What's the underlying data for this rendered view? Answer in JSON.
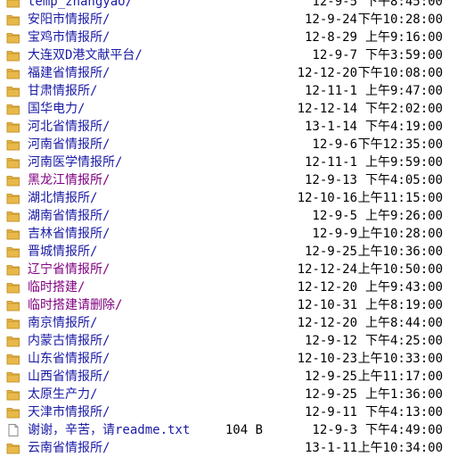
{
  "colors": {
    "link": "#1a1aa6",
    "visited": "#800080",
    "folder": "#e8b84a",
    "folder_dark": "#c9962c"
  },
  "entries": [
    {
      "name": "temp_zhangyao/",
      "type": "folder",
      "visited": false,
      "size": "",
      "date": "12-9-5",
      "time": "下午8:45:00"
    },
    {
      "name": "安阳市情报所/",
      "type": "folder",
      "visited": false,
      "size": "",
      "date": "12-9-24",
      "time": "下午10:28:00"
    },
    {
      "name": "宝鸡市情报所/",
      "type": "folder",
      "visited": false,
      "size": "",
      "date": "12-8-29",
      "time": "上午9:16:00"
    },
    {
      "name": "大连双D港文献平台/",
      "type": "folder",
      "visited": false,
      "size": "",
      "date": "12-9-7",
      "time": "下午3:59:00"
    },
    {
      "name": "福建省情报所/",
      "type": "folder",
      "visited": false,
      "size": "",
      "date": "12-12-20",
      "time": "下午10:08:00"
    },
    {
      "name": "甘肃情报所/",
      "type": "folder",
      "visited": false,
      "size": "",
      "date": "12-11-1",
      "time": "上午9:47:00"
    },
    {
      "name": "国华电力/",
      "type": "folder",
      "visited": false,
      "size": "",
      "date": "12-12-14",
      "time": "下午2:02:00"
    },
    {
      "name": "河北省情报所/",
      "type": "folder",
      "visited": false,
      "size": "",
      "date": "13-1-14",
      "time": "下午4:19:00"
    },
    {
      "name": "河南省情报所/",
      "type": "folder",
      "visited": false,
      "size": "",
      "date": "12-9-6",
      "time": "下午12:35:00"
    },
    {
      "name": "河南医学情报所/",
      "type": "folder",
      "visited": false,
      "size": "",
      "date": "12-11-1",
      "time": "上午9:59:00"
    },
    {
      "name": "黑龙江情报所/",
      "type": "folder",
      "visited": true,
      "size": "",
      "date": "12-9-13",
      "time": "下午4:05:00"
    },
    {
      "name": "湖北情报所/",
      "type": "folder",
      "visited": false,
      "size": "",
      "date": "12-10-16",
      "time": "上午11:15:00"
    },
    {
      "name": "湖南省情报所/",
      "type": "folder",
      "visited": false,
      "size": "",
      "date": "12-9-5",
      "time": "上午9:26:00"
    },
    {
      "name": "吉林省情报所/",
      "type": "folder",
      "visited": false,
      "size": "",
      "date": "12-9-9",
      "time": "上午10:28:00"
    },
    {
      "name": "晋城情报所/",
      "type": "folder",
      "visited": false,
      "size": "",
      "date": "12-9-25",
      "time": "上午10:36:00"
    },
    {
      "name": "辽宁省情报所/",
      "type": "folder",
      "visited": true,
      "size": "",
      "date": "12-12-24",
      "time": "上午10:50:00"
    },
    {
      "name": "临时搭建/",
      "type": "folder",
      "visited": true,
      "size": "",
      "date": "12-12-20",
      "time": "上午9:43:00"
    },
    {
      "name": "临时搭建请删除/",
      "type": "folder",
      "visited": true,
      "size": "",
      "date": "12-10-31",
      "time": "上午8:19:00"
    },
    {
      "name": "南京情报所/",
      "type": "folder",
      "visited": false,
      "size": "",
      "date": "12-12-20",
      "time": "上午8:44:00"
    },
    {
      "name": "内蒙古情报所/",
      "type": "folder",
      "visited": false,
      "size": "",
      "date": "12-9-12",
      "time": "下午4:25:00"
    },
    {
      "name": "山东省情报所/",
      "type": "folder",
      "visited": false,
      "size": "",
      "date": "12-10-23",
      "time": "上午10:33:00"
    },
    {
      "name": "山西省情报所/",
      "type": "folder",
      "visited": false,
      "size": "",
      "date": "12-9-25",
      "time": "上午11:17:00"
    },
    {
      "name": "太原生产力/",
      "type": "folder",
      "visited": false,
      "size": "",
      "date": "12-9-25",
      "time": "上午1:36:00"
    },
    {
      "name": "天津市情报所/",
      "type": "folder",
      "visited": false,
      "size": "",
      "date": "12-9-11",
      "time": "下午4:13:00"
    },
    {
      "name": "谢谢，辛苦，请readme.txt",
      "type": "file",
      "visited": false,
      "size": "104 B",
      "date": "12-9-3",
      "time": "下午4:49:00"
    },
    {
      "name": "云南省情报所/",
      "type": "folder",
      "visited": false,
      "size": "",
      "date": "13-1-11",
      "time": "上午10:34:00"
    }
  ]
}
